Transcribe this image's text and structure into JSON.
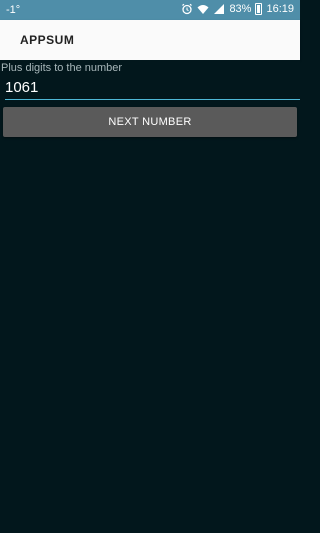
{
  "status_bar": {
    "left_text": "-1°",
    "battery_percent": "83%",
    "time": "16:19",
    "icons": [
      "alarm-icon",
      "wifi-icon",
      "signal-icon",
      "battery-icon"
    ]
  },
  "app_bar": {
    "title": "APPSUM"
  },
  "form": {
    "field_label": "Plus digits to the number",
    "field_value": "1061",
    "button_label": "NEXT NUMBER"
  },
  "colors": {
    "status_bar": "#4f8ea9",
    "background": "#02171c",
    "accent": "#4fb8d6",
    "button": "#5a5a5a"
  }
}
